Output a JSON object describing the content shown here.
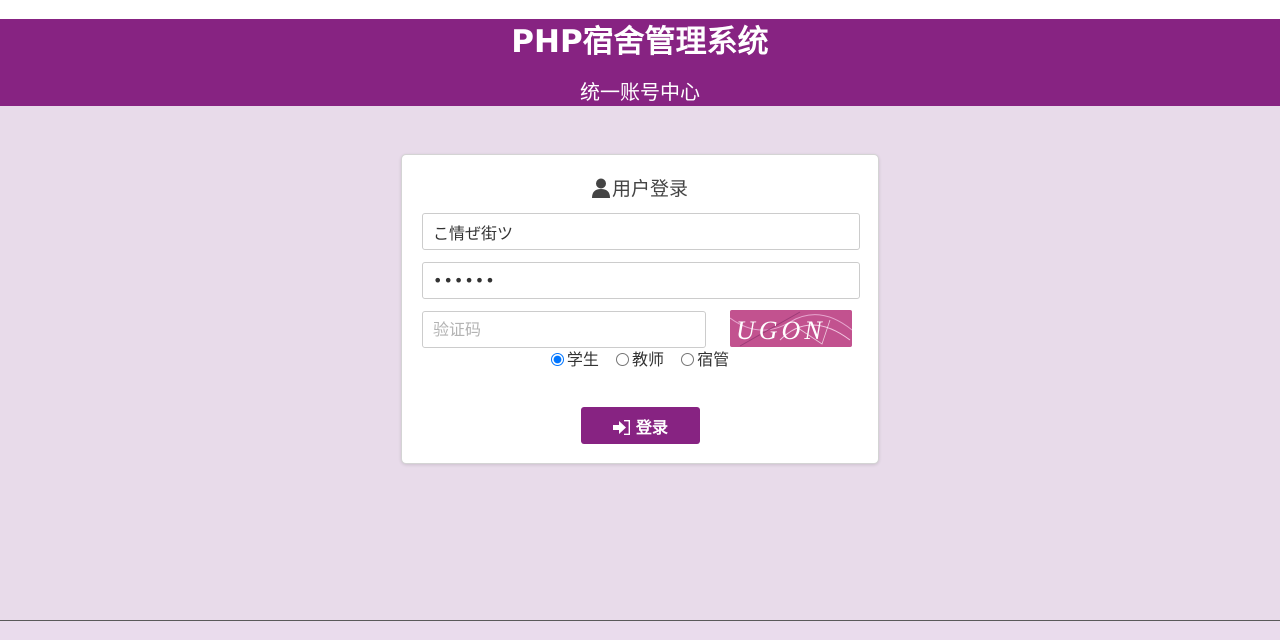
{
  "app": {
    "title": "PHP宿舍管理系统",
    "subtitle": "统一账号中心"
  },
  "login": {
    "heading": "用户登录",
    "username_value": "こ情ぜ街ツ",
    "password_value": "••••••",
    "captcha_placeholder": "验证码",
    "captcha_text": "UGON",
    "roles": [
      {
        "label": "学生",
        "selected": true
      },
      {
        "label": "教师",
        "selected": false
      },
      {
        "label": "宿管",
        "selected": false
      }
    ],
    "submit_label": "登录"
  },
  "colors": {
    "brand": "#872382",
    "background": "#e8dbea",
    "captcha_bg": "#c2528f"
  },
  "icons": {
    "heading": "user-icon",
    "submit": "sign-in-icon"
  }
}
